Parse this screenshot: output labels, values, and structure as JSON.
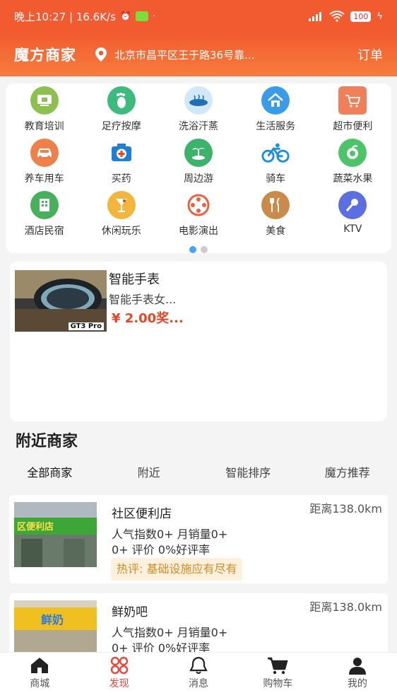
{
  "status_bar": {
    "time": "晚上10:27 | 16.6K/s",
    "battery": "100"
  },
  "header": {
    "title": "魔方商家",
    "location": "北京市昌平区王于路36号靠...",
    "orders": "订单"
  },
  "categories": [
    {
      "label": "教育培训",
      "icon": "education-icon",
      "color": "#7cb342"
    },
    {
      "label": "足疗按摩",
      "icon": "foot-icon",
      "color": "#3dbb7c"
    },
    {
      "label": "洗浴汗蒸",
      "icon": "bath-icon",
      "color": "#cfe6f7"
    },
    {
      "label": "生活服务",
      "icon": "home-icon",
      "color": "#3a9be8"
    },
    {
      "label": "超市便利",
      "icon": "cart-icon",
      "color": "#f0805a"
    },
    {
      "label": "养车用车",
      "icon": "car-icon",
      "color": "#f0804a"
    },
    {
      "label": "买药",
      "icon": "medicine-icon",
      "color": "#1f7fd6"
    },
    {
      "label": "周边游",
      "icon": "island-icon",
      "color": "#3bb36a"
    },
    {
      "label": "骑车",
      "icon": "bike-icon",
      "color": "#ffffff"
    },
    {
      "label": "蔬菜水果",
      "icon": "fruit-icon",
      "color": "#4cc56a"
    },
    {
      "label": "酒店民宿",
      "icon": "hotel-icon",
      "color": "#46b05a"
    },
    {
      "label": "休闲玩乐",
      "icon": "drink-icon",
      "color": "#f3b63c"
    },
    {
      "label": "电影演出",
      "icon": "film-icon",
      "color": "#ffffff"
    },
    {
      "label": "美食",
      "icon": "food-icon",
      "color": "#c98a4a"
    },
    {
      "label": "KTV",
      "icon": "microphone-icon",
      "color": "#5b6fe0"
    }
  ],
  "promo": {
    "title": "智能手表",
    "subtitle": "智能手表女...",
    "price": "¥ 2.00奖...",
    "badge": "GT3 Pro"
  },
  "nearby": {
    "title": "附近商家",
    "filters": [
      "全部商家",
      "附近",
      "智能排序",
      "魔方推荐"
    ]
  },
  "stores": [
    {
      "name": "社区便利店",
      "distance": "距离138.0km",
      "line1": "人气指数0+  月销量0+",
      "line2": "0+ 评价  0%好评率",
      "hot": "热评: 基础设施应有尽有"
    },
    {
      "name": "鲜奶吧",
      "distance": "距离138.0km",
      "line1": "人气指数0+  月销量0+",
      "line2": "0+ 评价  0%好评率"
    }
  ],
  "tabs": [
    {
      "label": "商城",
      "icon": "shop-icon"
    },
    {
      "label": "发现",
      "icon": "discover-icon"
    },
    {
      "label": "消息",
      "icon": "bell-icon"
    },
    {
      "label": "购物车",
      "icon": "cart-icon"
    },
    {
      "label": "我的",
      "icon": "user-icon"
    }
  ],
  "colors": {
    "brand": "#f25b30",
    "accent": "#e44a3a",
    "price": "#e64626"
  }
}
